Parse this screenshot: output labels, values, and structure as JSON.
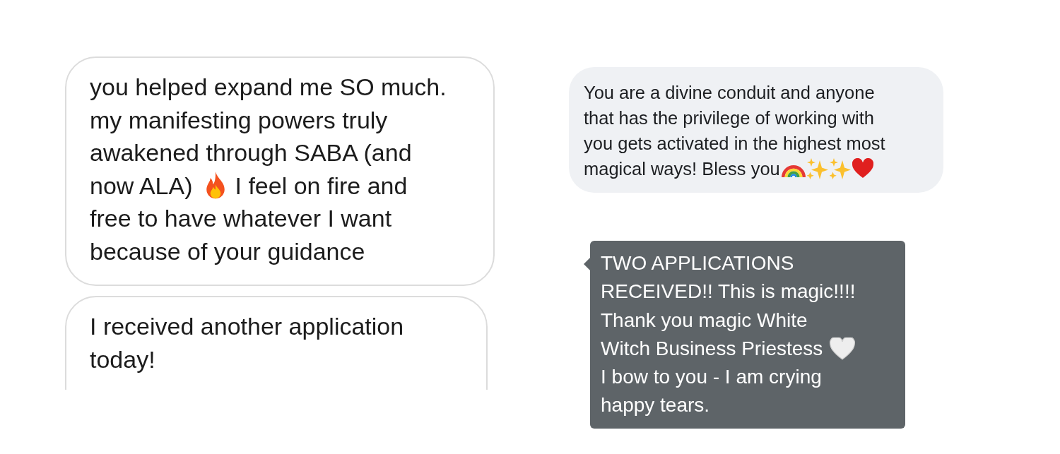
{
  "left_messages": [
    {
      "lines": [
        [
          {
            "kind": "text",
            "text": "you helped expand me SO much."
          }
        ],
        [
          {
            "kind": "text",
            "text": "my manifesting powers truly"
          }
        ],
        [
          {
            "kind": "text",
            "text": "awakened through SABA (and"
          }
        ],
        [
          {
            "kind": "text",
            "text": "now ALA)"
          },
          {
            "kind": "fire"
          },
          {
            "kind": "text",
            "text": "I feel on fire and"
          }
        ],
        [
          {
            "kind": "text",
            "text": "free to have whatever I want"
          }
        ],
        [
          {
            "kind": "text",
            "text": "because of your guidance"
          }
        ]
      ]
    },
    {
      "lines": [
        [
          {
            "kind": "text",
            "text": "I received another application"
          }
        ],
        [
          {
            "kind": "text",
            "text": "today!"
          }
        ]
      ]
    }
  ],
  "comment_bubble": {
    "lines": [
      [
        {
          "kind": "text",
          "text": "You are a divine conduit and anyone"
        }
      ],
      [
        {
          "kind": "text",
          "text": "that has the privilege of working with"
        }
      ],
      [
        {
          "kind": "text",
          "text": "you gets activated in the highest most"
        }
      ],
      [
        {
          "kind": "text",
          "text": "magical ways! Bless you"
        },
        {
          "kind": "rainbow"
        },
        {
          "kind": "sparkles"
        },
        {
          "kind": "sparkles"
        },
        {
          "kind": "heart"
        }
      ]
    ]
  },
  "chat_bubble": {
    "lines": [
      [
        {
          "kind": "text",
          "text": "TWO APPLICATIONS"
        }
      ],
      [
        {
          "kind": "text",
          "text": "RECEIVED!! This is magic!!!!"
        }
      ],
      [
        {
          "kind": "text",
          "text": "Thank you magic White"
        }
      ],
      [
        {
          "kind": "text",
          "text": "Witch Business Priestess"
        },
        {
          "kind": "white-heart"
        }
      ],
      [
        {
          "kind": "text",
          "text": "I bow to you - I am crying"
        }
      ],
      [
        {
          "kind": "text",
          "text": "happy tears."
        }
      ]
    ]
  }
}
